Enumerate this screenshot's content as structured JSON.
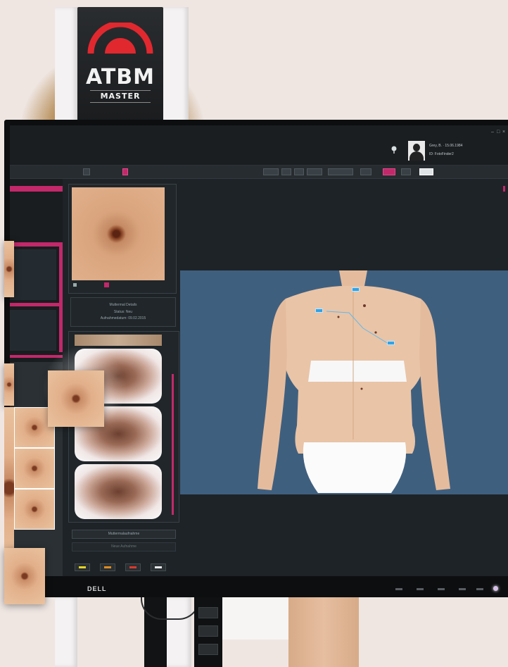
{
  "device": {
    "brand_main": "ATBM",
    "brand_sub": "MASTER",
    "logo_color": "#e1282f"
  },
  "monitor": {
    "maker": "DELL"
  },
  "app": {
    "window_controls": [
      "–",
      "□",
      "×"
    ],
    "patient": {
      "icon": "location-pin-icon",
      "line1": "Grey, B. · 15.06.1984",
      "line2": "ID: FotoFinder2"
    },
    "toolbar": {
      "accent_color": "#c2286a"
    },
    "lesion_panel": {
      "title": "Muttermal Details",
      "line1": "Status:  Neu",
      "line2": "Aufnahmedatum:  09.02.2015"
    },
    "buttons": {
      "capture": "Muttermalaufnahme",
      "compare": "Neue Aufnahme"
    },
    "swatch_colors": [
      "#e5d423",
      "#e08c1e",
      "#d93a2e",
      "#e8eaec"
    ],
    "body_background": "#3f5f7f"
  }
}
